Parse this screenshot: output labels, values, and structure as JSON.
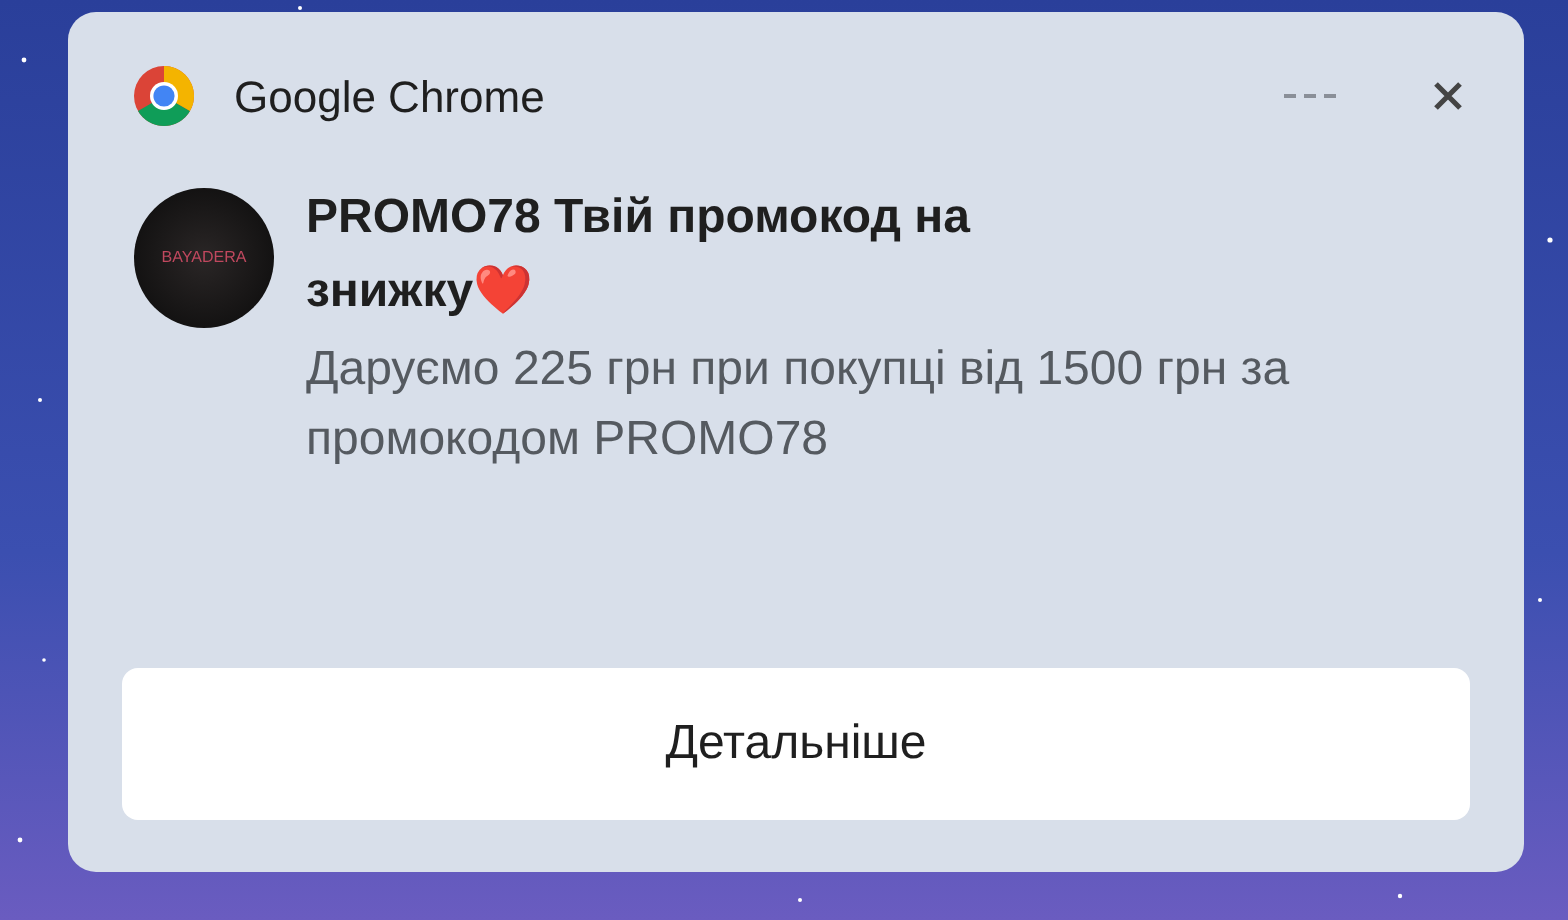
{
  "notification": {
    "app_name": "Google Chrome",
    "avatar_text": "BAYADERA",
    "title": "PROMO78 Твій промокод на знижку❤️",
    "body": "Даруємо 225 грн при покупці від 1500 грн за промокодом PROMO78",
    "action_button": "Детальніше"
  }
}
